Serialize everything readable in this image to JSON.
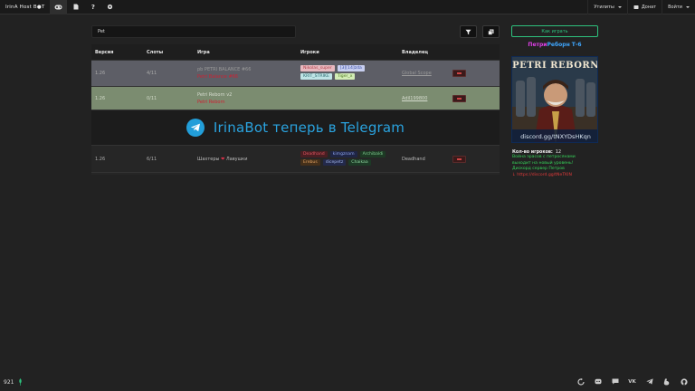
{
  "navbar": {
    "brand": "IrinA Host B●T",
    "utilities_label": "Утилиты",
    "donate_label": "Донат",
    "login_label": "Войти"
  },
  "toolbar": {
    "search_value": "Pet",
    "search_placeholder": ""
  },
  "table": {
    "headers": {
      "version": "Версия",
      "slots": "Слоты",
      "game": "Игра",
      "players": "Игроки",
      "owner": "Владелец"
    },
    "rows": [
      {
        "version": "1.26",
        "slots": "4/11",
        "game_name": "pb PETRI BALANCE #66",
        "game_sub": "Petri Balance #66",
        "owner": "Global Scope",
        "players": [
          {
            "name": "Nikolas_super",
            "color": "#b2404a",
            "bg": "#e7b9c0"
          },
          {
            "name": "[3][14]zda",
            "color": "#3d4fa6",
            "bg": "#c8cff0"
          },
          {
            "name": "KRIT_STRIKE",
            "color": "#2f6e72",
            "bg": "#bfe4e6"
          },
          {
            "name": "Tiger_x",
            "color": "#4f7a22",
            "bg": "#d3ecb6"
          }
        ]
      },
      {
        "version": "1.26",
        "slots": "0/11",
        "game_name": "Petri Reborn v2",
        "game_sub": "Petri Reborn",
        "owner": "Adil199800",
        "players": []
      },
      {
        "version": "1.26",
        "slots": "6/11",
        "game_name": "Шахтеры",
        "game_name_tail": "Лавушки",
        "game_sub": "",
        "owner": "Deadhand",
        "players": [
          {
            "name": "Deadhand",
            "color": "#e05561",
            "bg": "#4a1e22"
          },
          {
            "name": "kimgznam",
            "color": "#8aa0e8",
            "bg": "#1f2545"
          },
          {
            "name": "Archibaldi",
            "color": "#7fc98f",
            "bg": "#1d3a24"
          },
          {
            "name": "Erebus",
            "color": "#e0a060",
            "bg": "#45301a"
          },
          {
            "name": "dicepetz",
            "color": "#9fb4e8",
            "bg": "#23294a"
          },
          {
            "name": "Chaikaa",
            "color": "#8fd6a0",
            "bg": "#1d3a26"
          }
        ]
      }
    ]
  },
  "banner": {
    "text": "IrinaBot теперь в Telegram"
  },
  "right_panel": {
    "how_to_play": "Как играть",
    "server_title_a": "Петри",
    "server_title_b": "Реборн Т-6",
    "poster_title": "PETRI REBORN",
    "poster_url": "discord.gg/tNXYDsHKqn",
    "players_count_label": "Кол-во игроков:",
    "players_count_value": "12",
    "info_lines": [
      {
        "text": "Война эрасов с петросянами",
        "color": "#36d65a"
      },
      {
        "text": "выходит на новый уровень!",
        "color": "#36d65a"
      },
      {
        "text": "Дискорд сервер Петров",
        "color": "#36d65a"
      },
      {
        "text": "↓ https://discord.gg/tNeTKIN",
        "color": "#e03a3a"
      }
    ]
  },
  "footer": {
    "version": "921"
  },
  "colors": {
    "accent_green": "#2ec27e",
    "row_active": "#7b8c70",
    "row_grey": "#5d5e66",
    "telegram": "#229ed9"
  }
}
